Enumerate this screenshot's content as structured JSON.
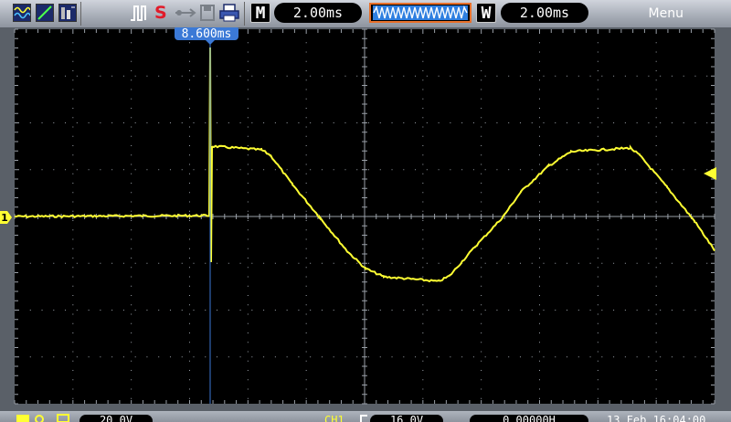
{
  "topbar": {
    "timebase": {
      "label": "M",
      "value": "2.00ms"
    },
    "window": {
      "label": "W",
      "value": "2.00ms"
    },
    "run_status": "S",
    "menu_label": "Menu"
  },
  "cursor": {
    "value": "8.600ms"
  },
  "channel": {
    "marker": "1",
    "color": "#ffff33"
  },
  "bottombar": {
    "ch1_scale": "20.0V",
    "trigger_source": "CH1",
    "trigger_level": "16.0V",
    "horizontal_position": "0.00000H",
    "datetime": "13 Feb 16:04:00"
  },
  "colors": {
    "trace": "#ffff33",
    "grid": "#9aa0a8",
    "accent_red": "#e11b2a",
    "window_orange": "#e8702a",
    "cursor_blue": "#3b79d6"
  }
}
